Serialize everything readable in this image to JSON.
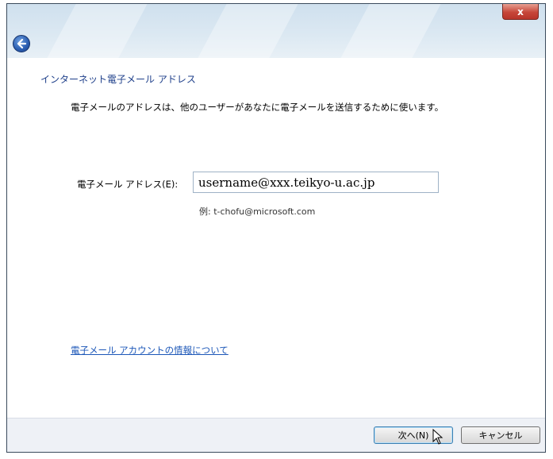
{
  "titlebar": {
    "close_symbol": "x",
    "back_icon": "back-arrow-icon"
  },
  "page": {
    "heading": "インターネット電子メール アドレス",
    "description": "電子メールのアドレスは、他のユーザーがあなたに電子メールを送信するために使います。",
    "email_label": "電子メール アドレス(E):",
    "email_value": "username@xxx.teikyo-u.ac.jp",
    "example": "例: t-chofu@microsoft.com",
    "help_link": "電子メール アカウントの情報について"
  },
  "footer": {
    "next_label": "次へ(N)",
    "cancel_label": "キャンセル"
  },
  "colors": {
    "accent": "#1e3f8a",
    "link": "#1c57b8",
    "close": "#c7473a"
  }
}
